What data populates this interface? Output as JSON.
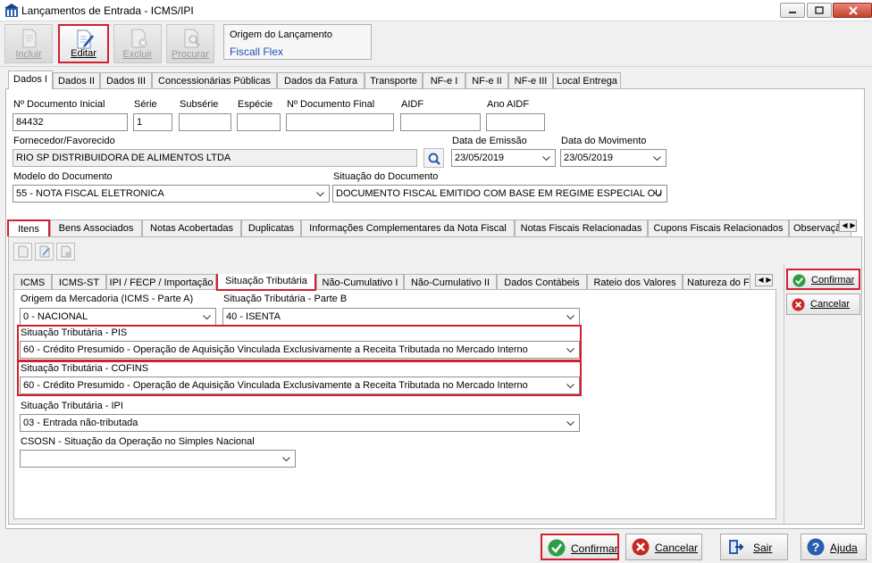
{
  "window": {
    "title": "Lançamentos de Entrada - ICMS/IPI"
  },
  "toolbar": {
    "incluir": "Incluir",
    "editar": "Editar",
    "excluir": "Excluir",
    "procurar": "Procurar"
  },
  "origin": {
    "title": "Origem do Lançamento",
    "value": "Fiscall Flex"
  },
  "top_tabs": [
    "Dados I",
    "Dados II",
    "Dados III",
    "Concessionárias Públicas",
    "Dados da Fatura",
    "Transporte",
    "NF-e I",
    "NF-e II",
    "NF-e III",
    "Local Entrega"
  ],
  "header": {
    "doc_inicial_label": "Nº Documento Inicial",
    "doc_inicial": "84432",
    "serie_label": "Série",
    "serie": "1",
    "subserie_label": "Subsérie",
    "especie_label": "Espécie",
    "doc_final_label": "Nº Documento Final",
    "aidf_label": "AIDF",
    "ano_aidf_label": "Ano AIDF",
    "fornecedor_label": "Fornecedor/Favorecido",
    "fornecedor": "RIO SP DISTRIBUIDORA DE ALIMENTOS LTDA",
    "data_emissao_label": "Data de Emissão",
    "data_emissao": "23/05/2019",
    "data_movimento_label": "Data do Movimento",
    "data_movimento": "23/05/2019",
    "modelo_label": "Modelo do Documento",
    "modelo": "55 - NOTA FISCAL ELETRONICA",
    "situacao_label": "Situação do Documento",
    "situacao": "DOCUMENTO FISCAL EMITIDO COM BASE EM REGIME ESPECIAL OU"
  },
  "mid_tabs": [
    "Itens",
    "Bens Associados",
    "Notas Acobertadas",
    "Duplicatas",
    "Informações Complementares da Nota Fiscal",
    "Notas Fiscais Relacionadas",
    "Cupons Fiscais Relacionados",
    "Observaçã"
  ],
  "inner_tabs": [
    "ICMS",
    "ICMS-ST",
    "IPI / FECP / Importação",
    "Situação Tributária",
    "Não-Cumulativo I",
    "Não-Cumulativo II",
    "Dados Contábeis",
    "Rateio dos Valores",
    "Natureza do F"
  ],
  "situacao_tributaria": {
    "origem_label": "Origem da Mercadoria (ICMS - Parte A)",
    "origem": "0 - NACIONAL",
    "parte_b_label": "Situação Tributária - Parte B",
    "parte_b": "40 - ISENTA",
    "pis_label": "Situação Tributária - PIS",
    "pis": "60 - Crédito Presumido - Operação de Aquisição Vinculada Exclusivamente a Receita Tributada no Mercado Interno",
    "cofins_label": "Situação Tributária - COFINS",
    "cofins": "60 - Crédito Presumido - Operação de Aquisição Vinculada Exclusivamente a Receita Tributada no Mercado Interno",
    "ipi_label": "Situação Tributária - IPI",
    "ipi": "03 - Entrada não-tributada",
    "csosn_label": "CSOSN - Situação da Operação no Simples Nacional",
    "csosn": ""
  },
  "side_buttons": {
    "confirmar": "Confirmar",
    "cancelar": "Cancelar"
  },
  "bottom_buttons": {
    "confirmar": "Confirmar",
    "cancelar": "Cancelar",
    "sair": "Sair",
    "ajuda": "Ajuda"
  },
  "colors": {
    "highlight": "#d1202f",
    "link": "#1f4fb8",
    "confirm": "#2e9e45",
    "cancel": "#c62828",
    "help": "#2a5db0"
  }
}
